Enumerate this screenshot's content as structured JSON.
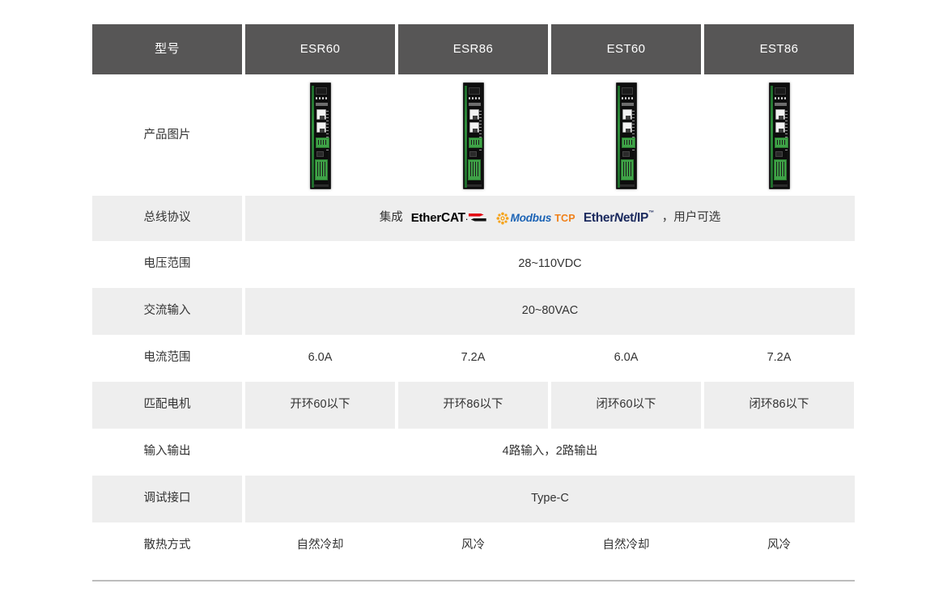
{
  "table": {
    "columns": [
      "型号",
      "ESR60",
      "ESR86",
      "EST60",
      "EST86"
    ],
    "rows": [
      {
        "id": "product-image",
        "label": "产品图片",
        "type": "images",
        "shaded": false,
        "values": [
          "ESR60 drive unit",
          "ESR86 drive unit",
          "EST60 drive unit",
          "EST86 drive unit"
        ]
      },
      {
        "id": "bus-protocol",
        "label": "总线协议",
        "type": "merged-logos",
        "shaded": true,
        "prefix": "集成",
        "suffix": "，用户可选",
        "logos": [
          "EtherCAT",
          "Modbus TCP",
          "EtherNet/IP"
        ]
      },
      {
        "id": "voltage-range",
        "label": "电压范围",
        "type": "merged",
        "shaded": false,
        "value": "28~110VDC"
      },
      {
        "id": "ac-input",
        "label": "交流输入",
        "type": "merged",
        "shaded": true,
        "value": "20~80VAC"
      },
      {
        "id": "current-range",
        "label": "电流范围",
        "type": "cells",
        "shaded": false,
        "values": [
          "6.0A",
          "7.2A",
          "6.0A",
          "7.2A"
        ]
      },
      {
        "id": "matched-motor",
        "label": "匹配电机",
        "type": "cells",
        "shaded": true,
        "values": [
          "开环60以下",
          "开环86以下",
          "闭环60以下",
          "闭环86以下"
        ]
      },
      {
        "id": "io",
        "label": "输入输出",
        "type": "merged",
        "shaded": false,
        "value": "4路输入，2路输出"
      },
      {
        "id": "debug-port",
        "label": "调试接口",
        "type": "merged",
        "shaded": true,
        "value": "Type-C"
      },
      {
        "id": "cooling",
        "label": "散热方式",
        "type": "cells",
        "shaded": false,
        "values": [
          "自然冷却",
          "风冷",
          "自然冷却",
          "风冷"
        ]
      }
    ]
  },
  "logos": {
    "ethercat": {
      "part1": "Ether",
      "part2": "CAT",
      "dot": "."
    },
    "modbus": {
      "name": "Modbus",
      "proto": "TCP"
    },
    "ethernetip": {
      "pre": "Ether",
      "n": "N",
      "post": "et/IP",
      "tm": "™"
    }
  },
  "colors": {
    "header_bg": "#575656",
    "header_text": "#ffffff",
    "shade_bg": "#eeeeee",
    "plain_bg": "#ffffff",
    "body_text": "#333333",
    "rule": "#bdbdbd",
    "ethercat_red": "#e3000f",
    "modbus_blue": "#1b63b5",
    "modbus_orange": "#f08019",
    "ethernetip_navy": "#1b2a5e",
    "terminal_green": "#3fa347"
  }
}
